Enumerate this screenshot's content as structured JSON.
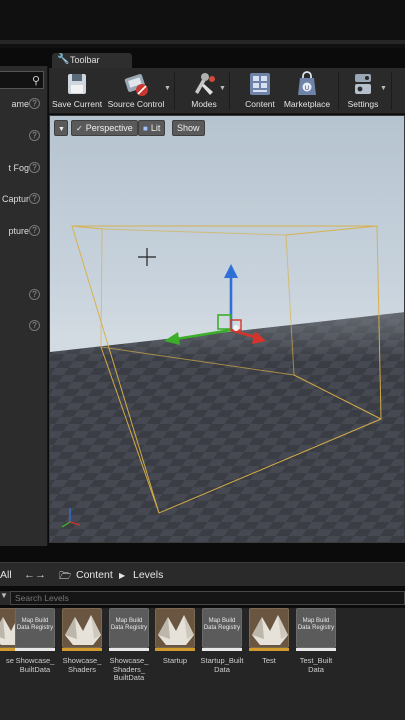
{
  "left_panel": {
    "rows": [
      "ame",
      "t Fog",
      "Captur",
      "pture"
    ]
  },
  "toolbar": {
    "tab_label": "Toolbar",
    "buttons": {
      "save": "Save Current",
      "source_control": "Source Control",
      "modes": "Modes",
      "content": "Content",
      "marketplace": "Marketplace",
      "settings": "Settings"
    }
  },
  "viewport": {
    "perspective": "Perspective",
    "lit": "Lit",
    "show": "Show"
  },
  "content_browser": {
    "all": "All",
    "breadcrumb_content": "Content",
    "breadcrumb_levels": "Levels",
    "search_placeholder": "Search Levels",
    "registry_thumb": "Map Build Data Registry",
    "assets": [
      {
        "name": "se",
        "kind": "map"
      },
      {
        "name": "Showcase_ BuiltData",
        "kind": "registry"
      },
      {
        "name": "Showcase_ Shaders",
        "kind": "map"
      },
      {
        "name": "Showcase_ Shaders_ BuiltData",
        "kind": "registry"
      },
      {
        "name": "Startup",
        "kind": "map"
      },
      {
        "name": "Startup_Built Data",
        "kind": "registry"
      },
      {
        "name": "Test",
        "kind": "map"
      },
      {
        "name": "Test_Built Data",
        "kind": "registry"
      }
    ]
  },
  "colors": {
    "map_bar": "#d29a2c",
    "registry_bar": "#e8e8e8",
    "selection_box": "#d8b048",
    "axis_z": "#2f6fd6",
    "axis_y": "#3cae2a",
    "axis_x": "#d6342a"
  }
}
